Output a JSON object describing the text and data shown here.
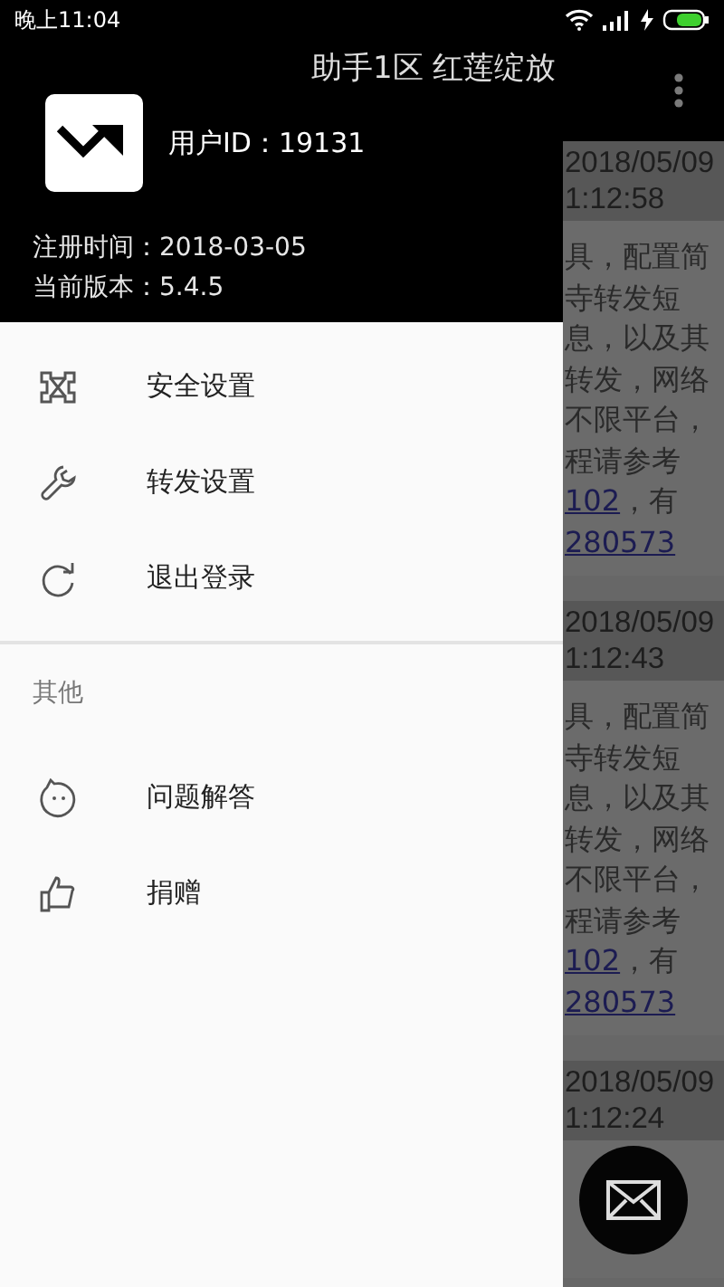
{
  "status_bar": {
    "time": "晚上11:04"
  },
  "app_bar": {
    "title": "助手1区 红莲绽放"
  },
  "messages": [
    {
      "date": "2018/05/09",
      "time": "1:12:58",
      "lines": [
        {
          "kind": "plain",
          "text": "具，配置简"
        },
        {
          "kind": "plain",
          "text": "寺转发短"
        },
        {
          "kind": "plain",
          "text": "息，以及其"
        },
        {
          "kind": "plain",
          "text": "转发，网络"
        },
        {
          "kind": "plain",
          "text": "不限平台，"
        },
        {
          "kind": "plain",
          "text": "程请参考"
        },
        {
          "kind": "link",
          "text": "102",
          "after": "，有"
        },
        {
          "kind": "link",
          "text": "280573"
        }
      ]
    },
    {
      "date": "2018/05/09",
      "time": "1:12:43",
      "lines": [
        {
          "kind": "plain",
          "text": "具，配置简"
        },
        {
          "kind": "plain",
          "text": "寺转发短"
        },
        {
          "kind": "plain",
          "text": "息，以及其"
        },
        {
          "kind": "plain",
          "text": "转发，网络"
        },
        {
          "kind": "plain",
          "text": "不限平台，"
        },
        {
          "kind": "plain",
          "text": "程请参考"
        },
        {
          "kind": "link",
          "text": "102",
          "after": "，有"
        },
        {
          "kind": "link",
          "text": "280573"
        }
      ]
    },
    {
      "date": "2018/05/09",
      "time": "1:12:24"
    }
  ],
  "drawer": {
    "user_id": "用户ID：19131",
    "registered": "注册时间：2018-03-05",
    "version": "当前版本：5.4.5",
    "items": [
      {
        "label": "安全设置"
      },
      {
        "label": "转发设置"
      },
      {
        "label": "退出登录"
      }
    ],
    "section": "其他",
    "other_items": [
      {
        "label": "问题解答"
      },
      {
        "label": "捐赠"
      }
    ]
  }
}
